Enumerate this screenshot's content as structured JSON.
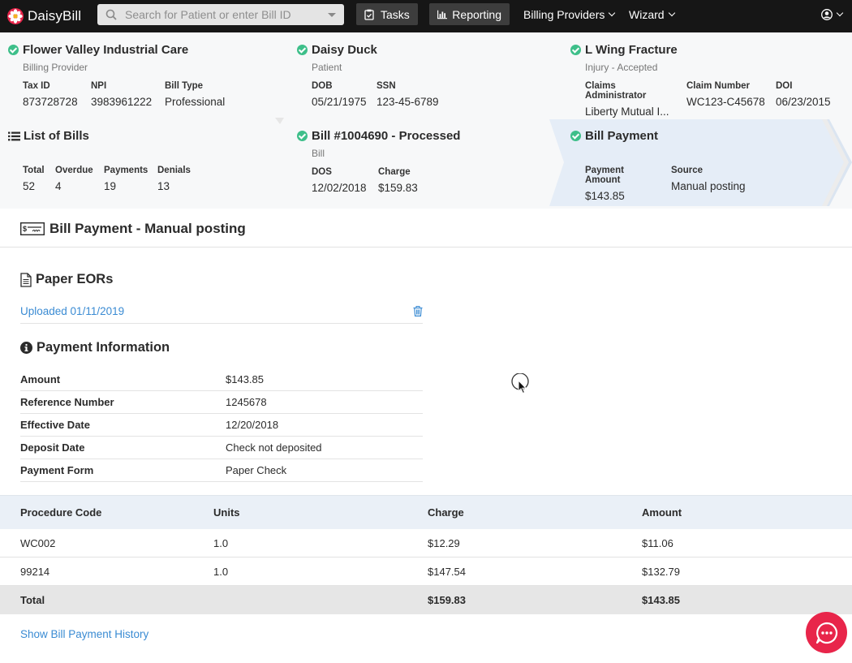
{
  "app": {
    "logo_text": "DaisyBill"
  },
  "nav": {
    "search_placeholder": "Search for Patient or enter Bill ID",
    "tasks_label": "Tasks",
    "reporting_label": "Reporting",
    "billing_providers_label": "Billing Providers",
    "wizard_label": "Wizard"
  },
  "provider": {
    "name": "Flower Valley Industrial Care",
    "type": "Billing Provider",
    "fields": [
      {
        "label": "Tax ID",
        "value": "873728728"
      },
      {
        "label": "NPI",
        "value": "3983961222"
      },
      {
        "label": "Bill Type",
        "value": "Professional"
      }
    ]
  },
  "patient": {
    "name": "Daisy Duck",
    "type": "Patient",
    "fields": [
      {
        "label": "DOB",
        "value": "05/21/1975"
      },
      {
        "label": "SSN",
        "value": "123-45-6789"
      }
    ]
  },
  "injury": {
    "name": "L Wing Fracture",
    "type": "Injury - Accepted",
    "fields": [
      {
        "label": "Claims Administrator",
        "value": "Liberty Mutual I..."
      },
      {
        "label": "Claim Number",
        "value": "WC123-C45678"
      },
      {
        "label": "DOI",
        "value": "06/23/2015"
      }
    ]
  },
  "bills": {
    "title": "List of Bills",
    "fields": [
      {
        "label": "Total",
        "value": "52"
      },
      {
        "label": "Overdue",
        "value": "4"
      },
      {
        "label": "Payments",
        "value": "19"
      },
      {
        "label": "Denials",
        "value": "13"
      }
    ]
  },
  "bill": {
    "title": "Bill #1004690 - Processed",
    "type": "Bill",
    "fields": [
      {
        "label": "DOS",
        "value": "12/02/2018"
      },
      {
        "label": "Charge",
        "value": "$159.83"
      }
    ]
  },
  "bill_payment_card": {
    "title": "Bill Payment",
    "fields": [
      {
        "label": "Payment Amount",
        "value": "$143.85"
      },
      {
        "label": "Source",
        "value": "Manual posting"
      }
    ]
  },
  "main": {
    "title": "Bill Payment - Manual posting",
    "paper_eors_title": "Paper EORs",
    "uploaded_link": "Uploaded 01/11/2019",
    "payment_info_title": "Payment Information",
    "payment_info": [
      {
        "label": "Amount",
        "value": "$143.85"
      },
      {
        "label": "Reference Number",
        "value": "1245678"
      },
      {
        "label": "Effective Date",
        "value": "12/20/2018"
      },
      {
        "label": "Deposit Date",
        "value": "Check not deposited"
      },
      {
        "label": "Payment Form",
        "value": "Paper Check"
      }
    ],
    "procedures": {
      "headers": [
        "Procedure Code",
        "Units",
        "Charge",
        "Amount"
      ],
      "rows": [
        [
          "WC002",
          "1.0",
          "$12.29",
          "$11.06"
        ],
        [
          "99214",
          "1.0",
          "$147.54",
          "$132.79"
        ]
      ],
      "total": [
        "Total",
        "",
        "$159.83",
        "$143.85"
      ]
    },
    "history_link": "Show Bill Payment History"
  },
  "colors": {
    "nav_bg": "#161616",
    "accent_green": "#3ebf8a",
    "link_blue": "#3a8bd3",
    "chat_red": "#e8254a",
    "active_panel": "#e5edf7"
  }
}
